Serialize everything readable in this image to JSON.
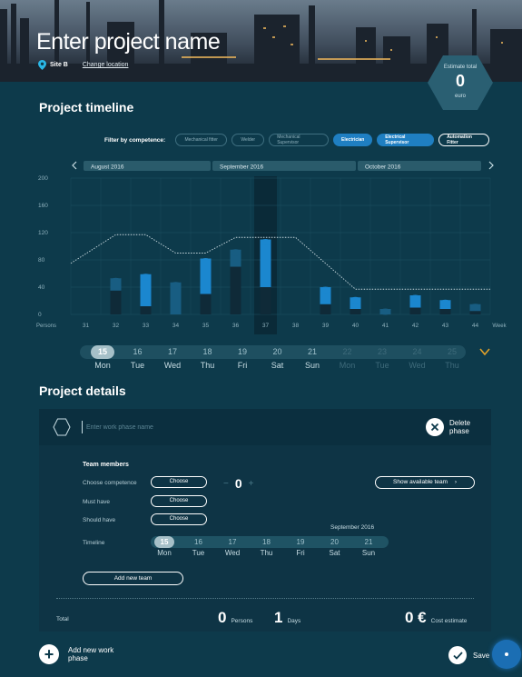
{
  "header": {
    "project_name_placeholder": "Enter project name",
    "site": "Site B",
    "change_location": "Change location"
  },
  "estimate": {
    "label": "Estimate total",
    "value": "0",
    "unit": "euro"
  },
  "timeline": {
    "title": "Project timeline",
    "filter_label": "Filter by competence:",
    "filters": [
      {
        "label": "Mechanical fitter",
        "state": "inactive"
      },
      {
        "label": "Welder",
        "state": "inactive"
      },
      {
        "label": "Mechanical Supervisor",
        "state": "inactive"
      },
      {
        "label": "Electrician",
        "state": "active"
      },
      {
        "label": "Electrical Supervisor",
        "state": "active"
      },
      {
        "label": "Automation Fitter",
        "state": "outlined"
      }
    ],
    "months": [
      "August 2016",
      "September 2016",
      "October 2016"
    ]
  },
  "chart_data": {
    "type": "bar",
    "ylabel": "Persons",
    "xlabel": "Week",
    "ylim": [
      0,
      200
    ],
    "yticks": [
      0,
      40,
      80,
      120,
      160,
      200
    ],
    "categories": [
      "31",
      "32",
      "33",
      "34",
      "35",
      "36",
      "37",
      "38",
      "39",
      "40",
      "41",
      "42",
      "43",
      "44"
    ],
    "highlighted_week": "37",
    "series": [
      {
        "values": [
          0,
          35,
          12,
          0,
          30,
          70,
          40,
          0,
          15,
          8,
          0,
          10,
          8,
          5
        ]
      },
      {
        "values": [
          0,
          18,
          47,
          47,
          52,
          25,
          70,
          0,
          25,
          17,
          8,
          18,
          13,
          10
        ]
      }
    ],
    "capacity_line": [
      75,
      117,
      117,
      90,
      90,
      113,
      113,
      113,
      75,
      37,
      37,
      37,
      37,
      37
    ],
    "colors": {
      "dark": "#0f2a38",
      "mid": "#185d82",
      "bright": "#1b87cf",
      "line": "#c8d8de"
    }
  },
  "week_days": [
    {
      "num": "15",
      "name": "Mon",
      "state": "selected"
    },
    {
      "num": "16",
      "name": "Tue",
      "state": "normal"
    },
    {
      "num": "17",
      "name": "Wed",
      "state": "normal"
    },
    {
      "num": "18",
      "name": "Thu",
      "state": "normal"
    },
    {
      "num": "19",
      "name": "Fri",
      "state": "normal"
    },
    {
      "num": "20",
      "name": "Sat",
      "state": "normal"
    },
    {
      "num": "21",
      "name": "Sun",
      "state": "normal"
    },
    {
      "num": "22",
      "name": "Mon",
      "state": "dim"
    },
    {
      "num": "23",
      "name": "Tue",
      "state": "dim"
    },
    {
      "num": "24",
      "name": "Wed",
      "state": "dim"
    },
    {
      "num": "25",
      "name": "Thu",
      "state": "dim"
    }
  ],
  "details": {
    "title": "Project details",
    "phase_placeholder": "Enter work phase name",
    "delete_phase": "Delete phase",
    "team_members": "Team members",
    "choose_competence": "Choose competence",
    "must_have": "Must have",
    "should_have": "Should have",
    "timeline_label": "Timeline",
    "choose": "Choose",
    "count": "0",
    "minus": "−",
    "plus": "+",
    "show_team": "Show available team",
    "month": "September 2016",
    "days": [
      {
        "num": "15",
        "name": "Mon",
        "state": "selected"
      },
      {
        "num": "16",
        "name": "Tue",
        "state": "normal"
      },
      {
        "num": "17",
        "name": "Wed",
        "state": "normal"
      },
      {
        "num": "18",
        "name": "Thu",
        "state": "normal"
      },
      {
        "num": "19",
        "name": "Fri",
        "state": "normal"
      },
      {
        "num": "20",
        "name": "Sat",
        "state": "normal"
      },
      {
        "num": "21",
        "name": "Sun",
        "state": "normal"
      }
    ],
    "add_team": "Add new team",
    "total_label": "Total",
    "persons_value": "0",
    "persons_label": "Persons",
    "days_value": "1",
    "days_label": "Days",
    "cost_value": "0 €",
    "cost_label": "Cost estimate"
  },
  "footer": {
    "add_phase": "Add new work phase",
    "save": "Save"
  }
}
